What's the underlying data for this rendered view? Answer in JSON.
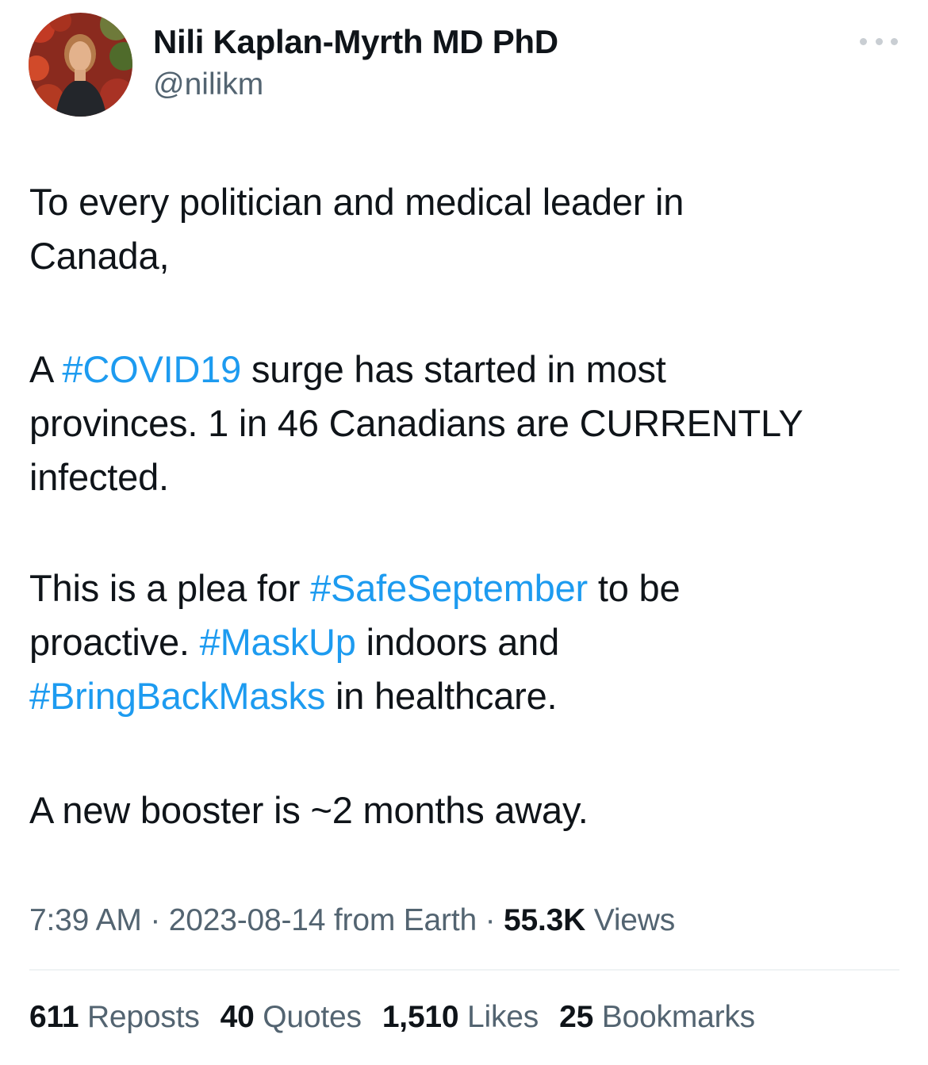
{
  "author": {
    "display_name": "Nili Kaplan-Myrth MD PhD",
    "handle": "@nilikm"
  },
  "tweet": {
    "greeting_line1": "To every politician and medical leader in",
    "greeting_line2": "Canada,",
    "p2_a": "A ",
    "hashtag_covid": "#COVID19",
    "p2_b": " surge has started in most",
    "p2_line2": "provinces. 1 in 46 Canadians are CURRENTLY",
    "p2_line3": "infected.",
    "p3_a": "This is a plea for ",
    "hashtag_safe": "#SafeSeptember",
    "p3_b": " to be",
    "p3_c": "proactive. ",
    "hashtag_mask": "#MaskUp",
    "p3_d": " indoors and",
    "hashtag_bring": "#BringBackMasks",
    "p3_e": " in healthcare.",
    "p4": "A new booster is ~2 months away."
  },
  "meta": {
    "time": "7:39 AM",
    "separator": " · ",
    "date": "2023-08-14",
    "source": " from Earth",
    "views_count": "55.3K",
    "views_label": " Views"
  },
  "stats": {
    "reposts_count": "611",
    "reposts_label": " Reposts",
    "quotes_count": "40",
    "quotes_label": " Quotes",
    "likes_count": "1,510",
    "likes_label": " Likes",
    "bookmarks_count": "25",
    "bookmarks_label": " Bookmarks"
  },
  "colors": {
    "text": "#0f1419",
    "secondary": "#536471",
    "link": "#1d9bf0",
    "divider": "#eff3f4"
  },
  "icons": {
    "more": "more-horizontal-icon"
  }
}
